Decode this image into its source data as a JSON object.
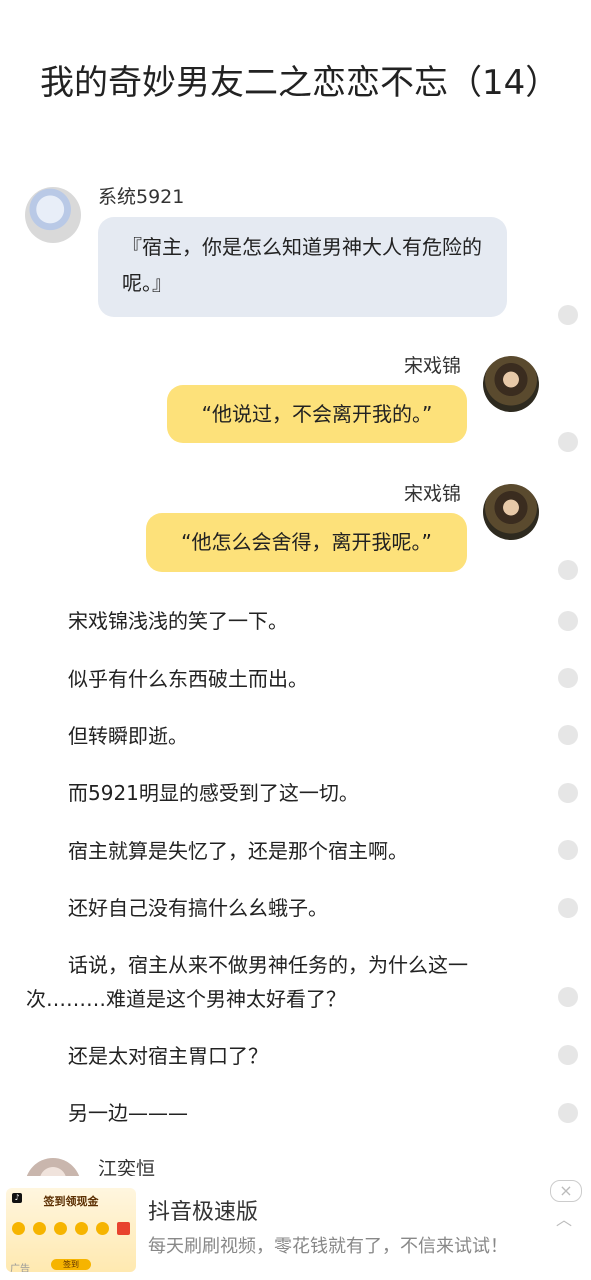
{
  "title": "我的奇妙男友二之恋恋不忘（14）",
  "messages": [
    {
      "speaker": "系统5921",
      "text": "『宿主，你是怎么知道男神大人有危险的呢。』"
    },
    {
      "speaker": "宋戏锦",
      "text": "“他说过，不会离开我的。”"
    },
    {
      "speaker": "宋戏锦",
      "text": "“他怎么会舍得，离开我呢。”"
    }
  ],
  "paragraphs": [
    "宋戏锦浅浅的笑了一下。",
    "似乎有什么东西破土而出。",
    "但转瞬即逝。",
    "而5921明显的感受到了这一切。",
    "宿主就算是失忆了，还是那个宿主啊。",
    "还好自己没有搞什么幺蛾子。",
    "话说，宿主从来不做男神任务的，为什么这一次………难道是这个男神太好看了？",
    "还是太对宿主胃口了？",
    "另一边———"
  ],
  "next_speaker": "江奕恒",
  "ad": {
    "thumb_heading": "签到领现金",
    "thumb_button": "签到",
    "thumb_tag": "广告",
    "title": "抖音极速版",
    "description": "每天刷刷视频，零花钱就有了，不信来试试！",
    "close_icon": "×",
    "chevron_icon": "︿"
  }
}
